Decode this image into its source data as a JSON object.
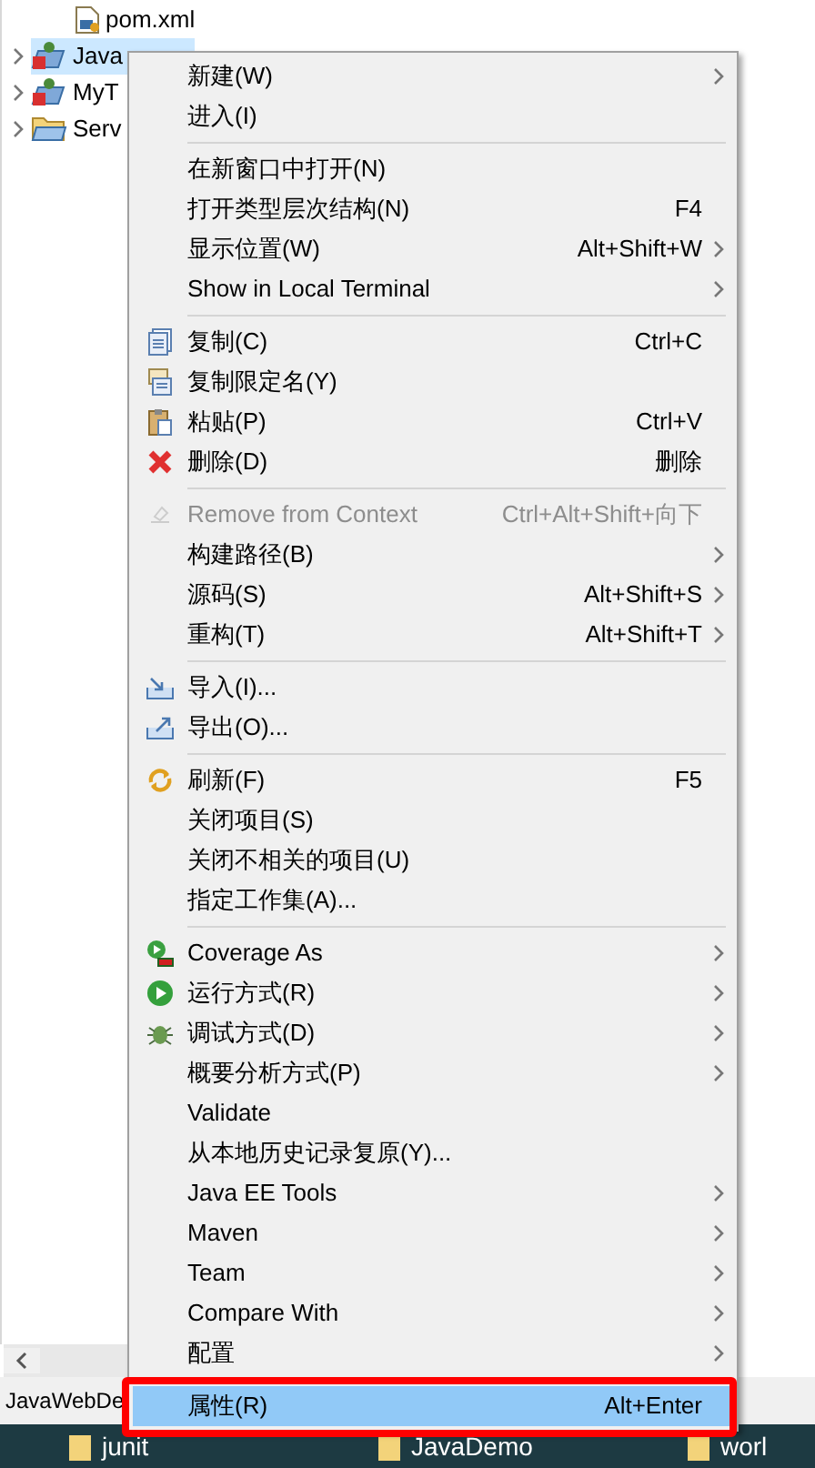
{
  "tree": [
    {
      "label": "pom.xml",
      "kind": "file",
      "selected": false
    },
    {
      "label": "Java",
      "kind": "project",
      "selected": true,
      "expanded": false
    },
    {
      "label": "MyT",
      "kind": "project",
      "selected": false,
      "expanded": false
    },
    {
      "label": "Serv",
      "kind": "folder",
      "selected": false,
      "expanded": false
    }
  ],
  "context_menu": [
    {
      "kind": "item",
      "label": "新建(W)",
      "submenu": true,
      "disabled": false,
      "selected": false
    },
    {
      "kind": "item",
      "label": "进入(I)",
      "submenu": false,
      "disabled": false,
      "selected": false
    },
    {
      "kind": "separator"
    },
    {
      "kind": "item",
      "label": "在新窗口中打开(N)",
      "submenu": false,
      "disabled": false,
      "selected": false
    },
    {
      "kind": "item",
      "label": "打开类型层次结构(N)",
      "shortcut": "F4",
      "submenu": false,
      "disabled": false,
      "selected": false
    },
    {
      "kind": "item",
      "label": "显示位置(W)",
      "shortcut": "Alt+Shift+W",
      "submenu": true,
      "disabled": false,
      "selected": false
    },
    {
      "kind": "item",
      "label": "Show in Local Terminal",
      "submenu": true,
      "disabled": false,
      "selected": false
    },
    {
      "kind": "separator"
    },
    {
      "kind": "item",
      "label": "复制(C)",
      "shortcut": "Ctrl+C",
      "submenu": false,
      "disabled": false,
      "selected": false
    },
    {
      "kind": "item",
      "label": "复制限定名(Y)",
      "submenu": false,
      "disabled": false,
      "selected": false
    },
    {
      "kind": "item",
      "label": "粘贴(P)",
      "shortcut": "Ctrl+V",
      "submenu": false,
      "disabled": false,
      "selected": false
    },
    {
      "kind": "item",
      "label": "删除(D)",
      "shortcut": "删除",
      "submenu": false,
      "disabled": false,
      "selected": false
    },
    {
      "kind": "separator"
    },
    {
      "kind": "item",
      "label": "Remove from Context",
      "shortcut": "Ctrl+Alt+Shift+向下",
      "submenu": false,
      "disabled": true,
      "selected": false
    },
    {
      "kind": "item",
      "label": "构建路径(B)",
      "submenu": true,
      "disabled": false,
      "selected": false
    },
    {
      "kind": "item",
      "label": "源码(S)",
      "shortcut": "Alt+Shift+S",
      "submenu": true,
      "disabled": false,
      "selected": false
    },
    {
      "kind": "item",
      "label": "重构(T)",
      "shortcut": "Alt+Shift+T",
      "submenu": true,
      "disabled": false,
      "selected": false
    },
    {
      "kind": "separator"
    },
    {
      "kind": "item",
      "label": "导入(I)...",
      "submenu": false,
      "disabled": false,
      "selected": false
    },
    {
      "kind": "item",
      "label": "导出(O)...",
      "submenu": false,
      "disabled": false,
      "selected": false
    },
    {
      "kind": "separator"
    },
    {
      "kind": "item",
      "label": "刷新(F)",
      "shortcut": "F5",
      "submenu": false,
      "disabled": false,
      "selected": false
    },
    {
      "kind": "item",
      "label": "关闭项目(S)",
      "submenu": false,
      "disabled": false,
      "selected": false
    },
    {
      "kind": "item",
      "label": "关闭不相关的项目(U)",
      "submenu": false,
      "disabled": false,
      "selected": false
    },
    {
      "kind": "item",
      "label": "指定工作集(A)...",
      "submenu": false,
      "disabled": false,
      "selected": false
    },
    {
      "kind": "separator"
    },
    {
      "kind": "item",
      "label": "Coverage As",
      "submenu": true,
      "disabled": false,
      "selected": false
    },
    {
      "kind": "item",
      "label": "运行方式(R)",
      "submenu": true,
      "disabled": false,
      "selected": false
    },
    {
      "kind": "item",
      "label": "调试方式(D)",
      "submenu": true,
      "disabled": false,
      "selected": false
    },
    {
      "kind": "item",
      "label": "概要分析方式(P)",
      "submenu": true,
      "disabled": false,
      "selected": false
    },
    {
      "kind": "item",
      "label": "Validate",
      "submenu": false,
      "disabled": false,
      "selected": false
    },
    {
      "kind": "item",
      "label": "从本地历史记录复原(Y)...",
      "submenu": false,
      "disabled": false,
      "selected": false
    },
    {
      "kind": "item",
      "label": "Java EE Tools",
      "submenu": true,
      "disabled": false,
      "selected": false
    },
    {
      "kind": "item",
      "label": "Maven",
      "submenu": true,
      "disabled": false,
      "selected": false
    },
    {
      "kind": "item",
      "label": "Team",
      "submenu": true,
      "disabled": false,
      "selected": false
    },
    {
      "kind": "item",
      "label": "Compare With",
      "submenu": true,
      "disabled": false,
      "selected": false
    },
    {
      "kind": "item",
      "label": "配置",
      "submenu": true,
      "disabled": false,
      "selected": false
    },
    {
      "kind": "separator"
    },
    {
      "kind": "item",
      "label": "属性(R)",
      "shortcut": "Alt+Enter",
      "submenu": false,
      "disabled": false,
      "selected": true
    }
  ],
  "status_bar": {
    "text": "JavaWebDe"
  },
  "taskbar": {
    "items": [
      {
        "label": "junit"
      },
      {
        "label": "JavaDemo"
      },
      {
        "label": "worl"
      }
    ]
  }
}
